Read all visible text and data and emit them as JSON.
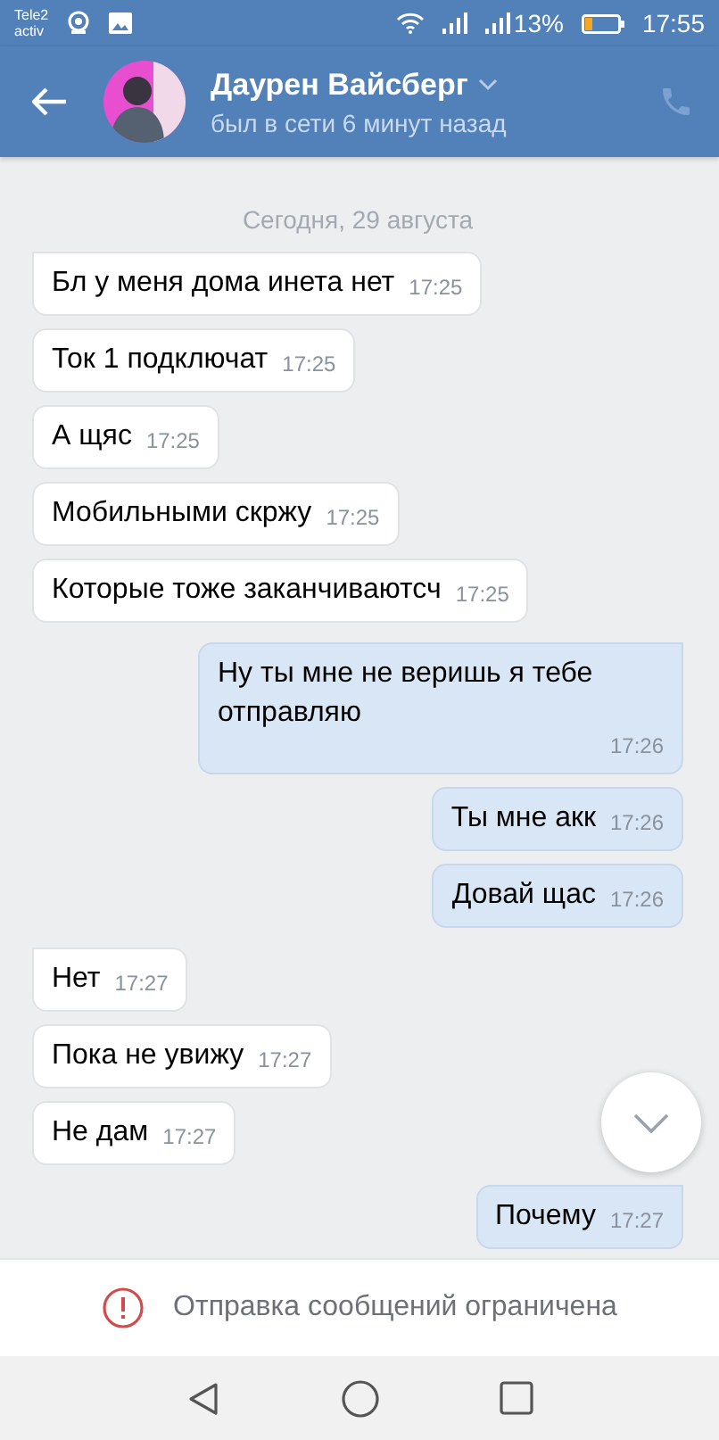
{
  "status_bar": {
    "carrier": [
      "Tele2",
      "activ"
    ],
    "battery": "13%",
    "time": "17:55"
  },
  "header": {
    "name": "Даурен Вайсберг",
    "status": "был в сети 6 минут назад"
  },
  "date_label": "Сегодня, 29 августа",
  "messages": [
    {
      "kind": "in",
      "text": "Бл у меня дома инета нет",
      "time": "17:25",
      "first": true
    },
    {
      "kind": "in",
      "text": "Ток 1  подключат",
      "time": "17:25",
      "first": false
    },
    {
      "kind": "in",
      "text": "А щяс",
      "time": "17:25",
      "first": false
    },
    {
      "kind": "in",
      "text": "Мобильными скржу",
      "time": "17:25",
      "first": false
    },
    {
      "kind": "in",
      "text": "Которые тоже заканчиваютсч",
      "time": "17:25",
      "first": false
    },
    {
      "kind": "out",
      "text": "Ну ты мне не веришь я тебе отправляю",
      "time": "17:26",
      "first": true
    },
    {
      "kind": "out",
      "text": "Ты мне акк",
      "time": "17:26",
      "first": false
    },
    {
      "kind": "out",
      "text": "Довай щас",
      "time": "17:26",
      "first": false
    },
    {
      "kind": "in",
      "text": "Нет",
      "time": "17:27",
      "first": true
    },
    {
      "kind": "in",
      "text": "Пока не увижу",
      "time": "17:27",
      "first": false
    },
    {
      "kind": "in",
      "text": "Не дам",
      "time": "17:27",
      "first": false
    },
    {
      "kind": "out",
      "text": "Почему",
      "time": "17:27",
      "first": true
    }
  ],
  "notice": "Отправка сообщений ограничена"
}
